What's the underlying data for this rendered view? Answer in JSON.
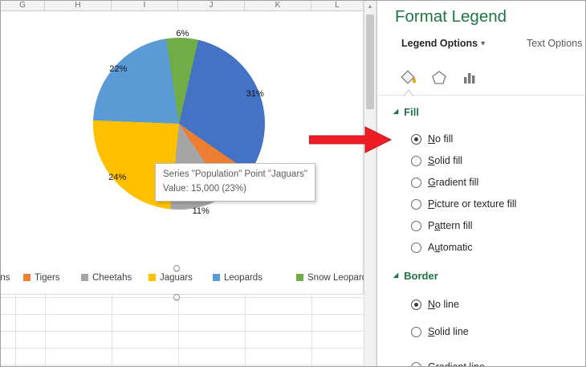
{
  "worksheet": {
    "column_headers": [
      "G",
      "H",
      "I",
      "J",
      "K",
      "L"
    ]
  },
  "chart_data": {
    "type": "pie",
    "title": "",
    "series_name": "Population",
    "categories": [
      "Lions",
      "Tigers",
      "Cheetahs",
      "Jaguars",
      "Leopards",
      "Snow Leopards"
    ],
    "values_percent": [
      31,
      6,
      11,
      24,
      22,
      6
    ],
    "colors": [
      "#4472C4",
      "#ED7D31",
      "#A5A5A5",
      "#FFC000",
      "#5B9BD5",
      "#70AD47"
    ],
    "start_angle_deg": 13,
    "data_label_format": "percent",
    "legend_position": "bottom",
    "selected_point": {
      "category": "Jaguars",
      "value_label": "15,000",
      "percent_label": "23%"
    }
  },
  "legend": {
    "items": [
      {
        "label": "Lions",
        "color": "#4472C4"
      },
      {
        "label": "Tigers",
        "color": "#ED7D31"
      },
      {
        "label": "Cheetahs",
        "color": "#A5A5A5"
      },
      {
        "label": "Jaguars",
        "color": "#FFC000"
      },
      {
        "label": "Leopards",
        "color": "#5B9BD5"
      },
      {
        "label": "Snow Leopards",
        "color": "#70AD47"
      }
    ]
  },
  "tooltip": {
    "line1": "Series \"Population\" Point \"Jaguars\"",
    "line2": "Value: 15,000 (23%)"
  },
  "panel": {
    "title": "Format Legend",
    "nav": {
      "options_tab": "Legend Options",
      "dropdown_glyph": "▾",
      "text_tab": "Text Options"
    },
    "fill": {
      "title": "Fill",
      "marker": "◢",
      "options": [
        {
          "pre": "",
          "acc": "N",
          "rest": "o fill",
          "selected": true
        },
        {
          "pre": "",
          "acc": "S",
          "rest": "olid fill",
          "selected": false
        },
        {
          "pre": "",
          "acc": "G",
          "rest": "radient fill",
          "selected": false
        },
        {
          "pre": "",
          "acc": "P",
          "rest": "icture or texture fill",
          "selected": false
        },
        {
          "pre": "P",
          "acc": "a",
          "rest": "ttern fill",
          "selected": false
        },
        {
          "pre": "A",
          "acc": "u",
          "rest": "tomatic",
          "selected": false
        }
      ]
    },
    "border": {
      "title": "Border",
      "marker": "◢",
      "options": [
        {
          "pre": "",
          "acc": "N",
          "rest": "o line",
          "selected": true
        },
        {
          "pre": "",
          "acc": "S",
          "rest": "olid line",
          "selected": false
        },
        {
          "pre": "",
          "acc": "G",
          "rest": "radient line",
          "selected": false
        }
      ]
    }
  },
  "icons": {
    "scroll_up_glyph": "▲"
  },
  "colors": {
    "excel_green": "#217346",
    "arrow_red": "#EE1C25",
    "scrollbar_thumb": "#C8C8C8"
  }
}
